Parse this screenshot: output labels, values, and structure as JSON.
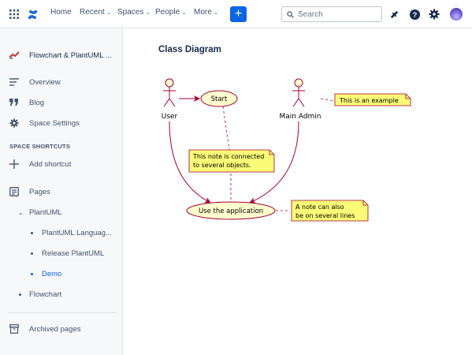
{
  "topnav": {
    "items": [
      "Home",
      "Recent",
      "Spaces",
      "People",
      "More"
    ],
    "search_placeholder": "Search"
  },
  "sidebar": {
    "space_name": "Flowchart & PlantUML ...",
    "overview": "Overview",
    "blog": "Blog",
    "space_settings": "Space Settings",
    "shortcuts_heading": "SPACE SHORTCUTS",
    "add_shortcut": "Add shortcut",
    "pages": "Pages",
    "tree": {
      "plantuml": "PlantUML",
      "plantuml_language": "PlantUML Languag...",
      "release_plantuml": "Release PlantUML",
      "demo": "Demo",
      "flowchart": "Flowchart"
    },
    "archived": "Archived pages"
  },
  "main": {
    "title": "Class Diagram"
  },
  "diagram": {
    "actors": {
      "user": "User",
      "admin": "Main Admin"
    },
    "usecases": {
      "start": "Start",
      "use_app": "Use the application"
    },
    "notes": {
      "example": "This is an example",
      "connected_line1": "This note is connected",
      "connected_line2": "to several objects.",
      "multi_line1": "A note can also",
      "multi_line2": "be on several lines"
    },
    "colors": {
      "actor_fill": "#fefece",
      "actor_stroke": "#a80036",
      "note_fill": "#fbfb77",
      "note_stroke": "#a80036"
    }
  }
}
